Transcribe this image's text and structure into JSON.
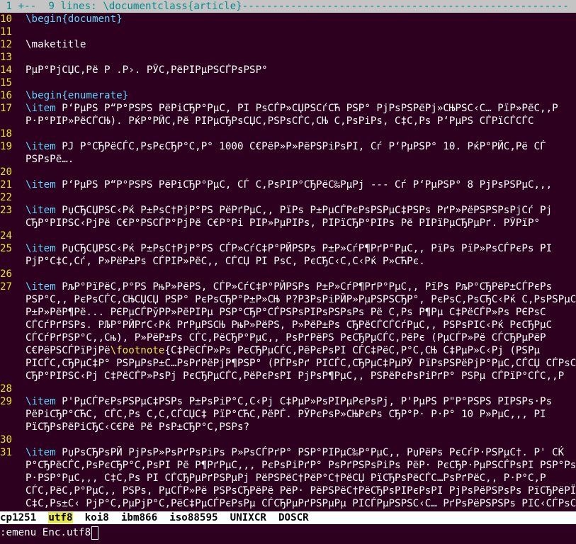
{
  "fold_line": {
    "number": " 1 ",
    "text": "+--  9 lines: \\documentclass{article}------------------------------------------------------"
  },
  "lines": [
    {
      "n": "10",
      "segs": [
        {
          "c": "cmd",
          "t": "\\begin{document}"
        }
      ]
    },
    {
      "n": "11",
      "segs": []
    },
    {
      "n": "12",
      "segs": [
        {
          "c": "",
          "t": "\\maketitle"
        }
      ]
    },
    {
      "n": "13",
      "segs": []
    },
    {
      "n": "14",
      "segs": [
        {
          "c": "",
          "t": "РµР°РјСЏС‚Рё Р .Р›. РЎС‚РёРІРµРЅСЃРѕРЅР°"
        }
      ]
    },
    {
      "n": "15",
      "segs": []
    },
    {
      "n": "16",
      "segs": [
        {
          "c": "cmd",
          "t": "\\begin{enumerate}"
        }
      ]
    },
    {
      "n": "17",
      "segs": [
        {
          "c": "cmd",
          "t": "\\item"
        },
        {
          "c": "",
          "t": " Р‘РµРЅ Р“Р°РЅРЅ РёРіСЂР°РµС‚ РІ РѕСЃР»СЏРЅСѓСЋ РЅР° РјРѕРЅРёРј»СЊРЅС‹С… РїР»РёС‚,Р"
        }
      ]
    },
    {
      "n": "  ",
      "segs": [
        {
          "c": "",
          "t": "Р·Р°РІР»РёСЃСЊ). РќР°РЙС‚Рё РІРµСЂРѕСЏС‚РЅРѕСЃС‚СЊ С‚РѕРіРѕ, С‡С‚Рѕ Р‘РµРЅ СЃРїСЃСЃС"
        }
      ]
    },
    {
      "n": "18",
      "segs": []
    },
    {
      "n": "19",
      "segs": [
        {
          "c": "cmd",
          "t": "\\item"
        },
        {
          "c": "",
          "t": " РЈ Р°СЂРёСЃС‚РѕРєСЂР°С‚Р° 1000 С€РёР»Р»РёРЅРіРѕРІ, Сѓ Р‘РµРЅР° 10. РќР°РЙС‚Рё СЃ"
        }
      ]
    },
    {
      "n": "  ",
      "segs": [
        {
          "c": "",
          "t": "РЅРѕРё…."
        }
      ]
    },
    {
      "n": "20",
      "segs": []
    },
    {
      "n": "21",
      "segs": [
        {
          "c": "cmd",
          "t": "\\item"
        },
        {
          "c": "",
          "t": " Р‘РµРЅ Р“Р°РЅРЅ РёРіСЂР°РµС‚ СЃ С‚РѕРІР°СЂРёС‰РµРј --- Сѓ Р‘РµРЅР° 8 РјРѕРЅРµС‚,,"
        }
      ]
    },
    {
      "n": "22",
      "segs": []
    },
    {
      "n": "23",
      "segs": [
        {
          "c": "cmd",
          "t": "\\item"
        },
        {
          "c": "",
          "t": " РџСЂСЏРЅС‹Рќ Р±РѕС†РјР°РЅ РёРґРµС‚, РїРѕ Р±РµСЃРєРѕРЅРµС‡РЅРѕ РґР»РёРЅРЅРѕРјСѓ Рј"
        }
      ]
    },
    {
      "n": "  ",
      "segs": [
        {
          "c": "",
          "t": "СЂР°РІРЅС‹РјРё С€Р°РЅСЃР°РјРё С€Р°Рі РІР»РµРІРѕ, РІРїСЂР°РІРѕ Рё РІРїРµСЂРµРґ. РЎРїР°"
        }
      ]
    },
    {
      "n": "24",
      "segs": []
    },
    {
      "n": "25",
      "segs": [
        {
          "c": "cmd",
          "t": "\\item"
        },
        {
          "c": "",
          "t": " РџСЂСЏРЅС‹Рќ Р±РѕС†РјР°РЅ СЃР»СѓС‡Р°РЙРЅРѕ Р±Р»СѓР¶РґР°РµС‚, РїРѕ РїР»РѕСЃРєРѕ РІ"
        }
      ]
    },
    {
      "n": "  ",
      "segs": [
        {
          "c": "",
          "t": "РјР°С‡С‚Сѓ, Р»РёР±Рѕ СЃРІР»РёС‚, СЃСЏ РІ РѕС, РєСЂС‹С‚С‹Рќ Р»СЋРє."
        }
      ]
    },
    {
      "n": "26",
      "segs": []
    },
    {
      "n": "27",
      "segs": [
        {
          "c": "cmd",
          "t": "\\item"
        },
        {
          "c": "",
          "t": " РљР°РїРёС‚Р°РЅ РњР»РёРЅ, СЃР»СѓС‡Р°РЙРЅРѕ Р±Р»СѓР¶РґР°РµС‚, РїРѕ РљР°СЂРёР±СЃРєРѕ"
        }
      ]
    },
    {
      "n": "  ",
      "segs": [
        {
          "c": "",
          "t": "РЅР°С‚, РєРѕСЃС‚СЊСЏСЏ РЅР° РєРѕСЂР°Р±Р»СЊ Р?РЗРѕРіРЙР»РµРЅРЅСЂР°, РєРѕС‚РѕСЂС‹Рќ С‚РѕРЅРµС"
        }
      ]
    },
    {
      "n": "  ",
      "segs": [
        {
          "c": "",
          "t": "Р±Р»РёР¶Рё... РЄРµСЃРўРР»РёРІРµ РЅР°СЂР°СЃРЅРѕРІРѕРЅРѕРѕ Рё С‚Рѕ Р¶Рµ С‡РёСЃР»Рѕ РЄРѕС"
        }
      ]
    },
    {
      "n": "  ",
      "segs": [
        {
          "c": "",
          "t": "СЃСѓРґРЅРѕ. РЉР°РЙРґС‹Рќ РґРµРЅСЊ РњР»РёРЅ, Р»РёР±Рѕ СЂРёСЃСЃСѓРµС‚, РЅРѕРІС‹Рќ РєСЂРµС"
        }
      ]
    },
    {
      "n": "  ",
      "segs": [
        {
          "c": "",
          "t": "СЃСѓРґРЅР°С‚,Сњ), Р»РёР±Рѕ СЃС‚РёСЂР°РµС‚, РѕРґРёРЅ РєСЂРµСЃС‚РёРє (РµСЃР»Рё СЃСЂРµРёР"
        }
      ]
    },
    {
      "n": "  ",
      "segs": [
        {
          "c": "",
          "t": "С€РёРЅСЃРїРјРё"
        },
        {
          "c": "hl",
          "t": "\\footnote"
        },
        {
          "c": "",
          "t": "{С‡РёСЃР»Рѕ РєСЂРµСЃС‚РёРєРѕРІ СЃС‡РёС‚Р°С‚СЊ С‡РµР»С‹Рј (РЅРµ"
        }
      ]
    },
    {
      "n": "  ",
      "segs": [
        {
          "c": "",
          "t": "РІСЃС‚СЂРµС‡Р° РЅРµРѕР±С…РѕРґРёРјР¶РЅР° (РЃРѕРґ РІСЃС‚СЂРµС‡РµРЎ РїРѕРЅРёРјР°РµС‚СЃСЏ СЃРѕС"
        }
      ]
    },
    {
      "n": "  ",
      "segs": [
        {
          "c": "",
          "t": "СЂР°РІРЅС‹Рј С‡РёСЃР»РѕРј РєСЂРµСЃС‚РёРєРѕРІ РјРѕР¶РµС‚, РЅРёРєРѕРіРґР° РЅРµ СЃРїР°СЃС‚,Р"
        }
      ]
    },
    {
      "n": "28",
      "segs": []
    },
    {
      "n": "29",
      "segs": [
        {
          "c": "cmd",
          "t": "\\item"
        },
        {
          "c": "",
          "t": " Р'РµСЃРєРѕРЅРµС‡РЅРѕ Р±РѕРіР°С‚С‹Рј С‡РµР»РѕРІРµРєРѕРј, Р'РµРЅ Р\"Р°РЅРЅ РІРЅРѕ·Рѕ"
        }
      ]
    },
    {
      "n": "  ",
      "segs": [
        {
          "c": "",
          "t": "РёРіСЂР°СЋС, СЃС‚Рѕ С,С‚СЃСЏС‡ РїР°СЋС‚РёРЃ. РЎРєРѕР»СЊРєРѕ СЂР°Р· Р·Р° 10 Р»РµС‚,, РІ"
        }
      ]
    },
    {
      "n": "  ",
      "segs": [
        {
          "c": "",
          "t": "РїСЂРѕРёРіСЂС‹С€Рё Рё РѕР±СЂР°С‚РЅРѕ?"
        }
      ]
    },
    {
      "n": "30",
      "segs": []
    },
    {
      "n": "31",
      "segs": [
        {
          "c": "cmd",
          "t": "\\item"
        },
        {
          "c": "",
          "t": " РџРѕСЂРѕРЙ РјРѕР»РѕРґРѕРіРѕ Р»РѕСЃРґР° РЅР°РІРµС‰Р°РµС‚, РџРёРѕ РєСѓР·РЅРµС†. Р' СЌ"
        }
      ]
    },
    {
      "n": "  ",
      "segs": [
        {
          "c": "",
          "t": "Р°СЂРёСЃС‚РѕРєСЂР°С‚РѕРІ Рё Р¶РґРµС‚,, РєРѕРіРґР° РѕРґРЅРѕРіРѕ РёР· РєСЂР·РµРЅСЃРѕРІ РЅР°Рѕ"
        }
      ]
    },
    {
      "n": "  ",
      "segs": [
        {
          "c": "",
          "t": "Р·РЅР°РµС‚,, С‡С‚Рѕ РІ СЃСЂРµРґРЅРµРј РёРЅРёС†РёР°С†РёСЏ РїСЂРѕРёСЃС…РѕРґРёС‚, Р·Р°С‚Р"
        }
      ]
    },
    {
      "n": "  ",
      "segs": [
        {
          "c": "",
          "t": "СЃС‚РёС‚Р°РµС‚, РЅРѕ, РµСЃР»Рё РЅРѕСЂРёРё РёР· РёРЅРёС†РёСЂРѕРІРєРѕРІ РјРѕРёРЅРѕРѕ РїСЂРёРЇРёР"
        }
      ]
    },
    {
      "n": "  ",
      "segs": [
        {
          "c": "",
          "t": "С‡С‚Рѕ±С‹ РјР°С‚РµРјР°С‚РёС‡РµСЃРєРѕРµ СЃСЂРµРґРЅРµРµ РІСЃРµРЅРЅС‹С… РґРѕРёРЅРЅРѕ РІС‹СЃРѕСЃР"
        }
      ]
    }
  ],
  "wildmenu": {
    "items": [
      "cp1251",
      "utf8",
      "koi8",
      "ibm866",
      "iso88595",
      "UNIXCR",
      "DOSCR"
    ],
    "selected_index": 1
  },
  "cmdline": {
    "text": ":emenu Enc.utf8"
  },
  "colors": {
    "background": "#2c001e",
    "linenr": "#e5e524",
    "keyword": "#5fd7ff",
    "fold_bg": "#c4c4c4",
    "fold_fg": "#008b8b",
    "wildmenu_sel": "#e8e84a"
  }
}
